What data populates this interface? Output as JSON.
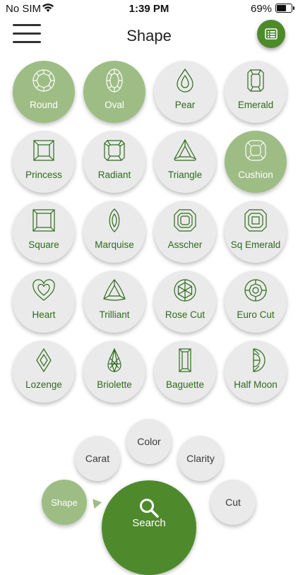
{
  "status_bar": {
    "carrier": "No SIM",
    "time": "1:39 PM",
    "battery": "69%"
  },
  "header": {
    "title": "Shape",
    "menu_icon": "hamburger-menu-icon",
    "list_icon": "list-icon"
  },
  "colors": {
    "accent": "#4e8a2c",
    "selected": "#9dbd85",
    "tile": "#eaeaea",
    "label": "#2f6a1c"
  },
  "shapes": [
    {
      "label": "Round",
      "selected": true
    },
    {
      "label": "Oval",
      "selected": true
    },
    {
      "label": "Pear",
      "selected": false
    },
    {
      "label": "Emerald",
      "selected": false
    },
    {
      "label": "Princess",
      "selected": false
    },
    {
      "label": "Radiant",
      "selected": false
    },
    {
      "label": "Triangle",
      "selected": false
    },
    {
      "label": "Cushion",
      "selected": true
    },
    {
      "label": "Square",
      "selected": false
    },
    {
      "label": "Marquise",
      "selected": false
    },
    {
      "label": "Asscher",
      "selected": false
    },
    {
      "label": "Sq Emerald",
      "selected": false
    },
    {
      "label": "Heart",
      "selected": false
    },
    {
      "label": "Trilliant",
      "selected": false
    },
    {
      "label": "Rose Cut",
      "selected": false
    },
    {
      "label": "Euro Cut",
      "selected": false
    },
    {
      "label": "Lozenge",
      "selected": false
    },
    {
      "label": "Briolette",
      "selected": false
    },
    {
      "label": "Baguette",
      "selected": false
    },
    {
      "label": "Half Moon",
      "selected": false
    }
  ],
  "bottom_menu": {
    "color": "Color",
    "carat": "Carat",
    "clarity": "Clarity",
    "shape": "Shape",
    "cut": "Cut",
    "search": "Search"
  }
}
